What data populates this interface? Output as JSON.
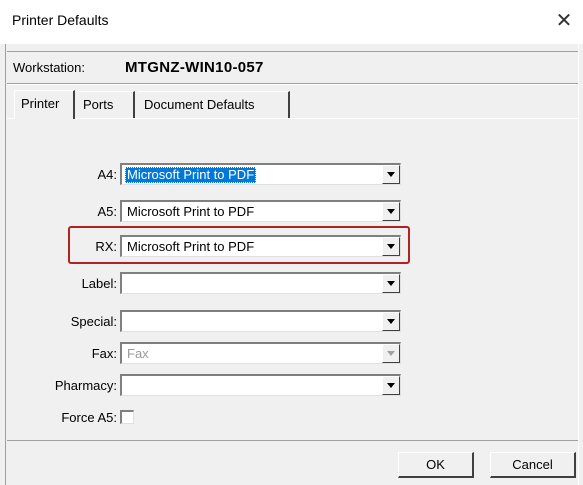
{
  "window": {
    "title": "Printer Defaults",
    "close_glyph": "✕"
  },
  "workstation": {
    "label": "Workstation:",
    "value": "MTGNZ-WIN10-057"
  },
  "tabs": [
    {
      "label": "Printer",
      "active": true
    },
    {
      "label": "Ports",
      "active": false
    },
    {
      "label": "Document Defaults",
      "active": false
    }
  ],
  "fields": {
    "a4": {
      "label": "A4:",
      "value": "Microsoft Print to PDF",
      "selected": true
    },
    "a5": {
      "label": "A5:",
      "value": "Microsoft Print to PDF"
    },
    "rx": {
      "label": "RX:",
      "value": "Microsoft Print to PDF",
      "highlighted": true
    },
    "label": {
      "label": "Label:",
      "value": ""
    },
    "special": {
      "label": "Special:",
      "value": ""
    },
    "fax": {
      "label": "Fax:",
      "value": "Fax",
      "disabled": true
    },
    "pharmacy": {
      "label": "Pharmacy:",
      "value": ""
    },
    "force_a5": {
      "label": "Force A5:",
      "checked": false
    }
  },
  "buttons": {
    "ok": "OK",
    "cancel": "Cancel"
  },
  "colors": {
    "selection": "#0078d7",
    "highlight_border": "#b22222",
    "dialog_bg": "#f0f0f0"
  },
  "icons": {
    "close": "close-icon",
    "dropdown": "chevron-down-icon"
  }
}
